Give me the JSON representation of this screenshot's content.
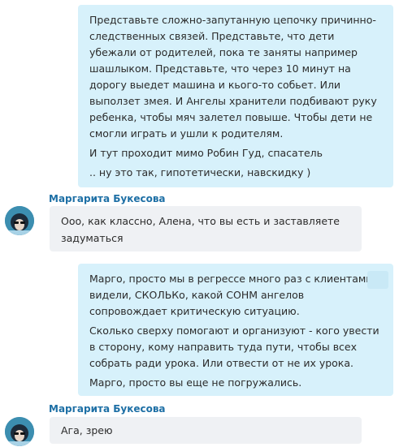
{
  "conversation": {
    "msg1": {
      "paragraphs": [
        "Представьте сложно-запутанную цепочку причинно-следственных связей.   Представьте, что дети убежали от родителей, пока те заняты например шашлыком. Представьте, что через 10 минут на дорогу выедет машина и кього-то собьет. Или выползет змея. И Ангелы хранители подбивают руку ребенка, чтобы мяч залетел повыше. Чтобы дети не смогли играть и ушли к родителям.",
        "И тут проходит мимо Робин Гуд, спасатель",
        ".. ну это так, гипотетически, навскидку )"
      ]
    },
    "msg2": {
      "sender": "Маргарита Букесова",
      "text": "Ооо, как классно, Алена, что вы есть и заставляете задуматься"
    },
    "msg3": {
      "paragraphs": [
        "Марго, просто мы в регрессе много раз с клиентами видели, СКОЛЬКо, какой СОНМ ангелов сопровождает критическую ситуацию.",
        "Сколько сверху помогают и организуют - кого увести в сторону, кому направить туда пути, чтобы всех собрать ради урока. Или отвести от не их урока.",
        "Марго, просто вы еще не погружались."
      ]
    },
    "msg4": {
      "sender": "Маргарита Букесова",
      "text": "Ага, зрею"
    }
  }
}
